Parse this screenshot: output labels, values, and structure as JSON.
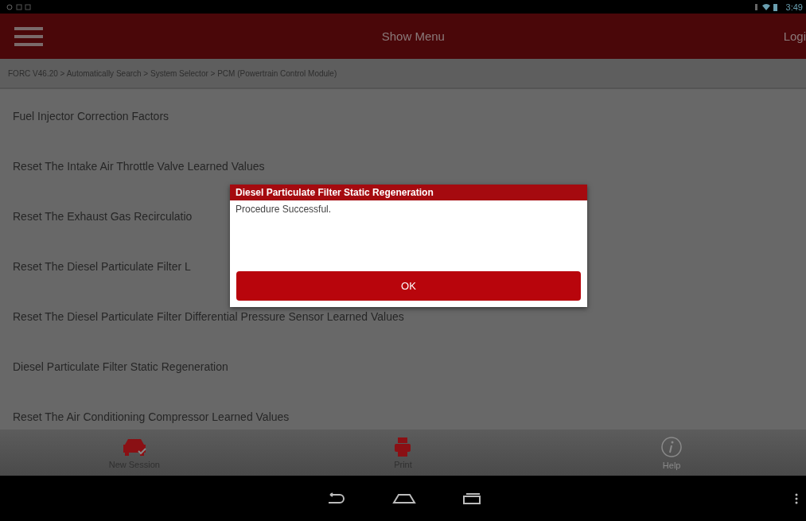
{
  "status_bar": {
    "time": "3:49"
  },
  "header": {
    "title": "Show Menu",
    "login": "Logi"
  },
  "breadcrumb": "FORC V46.20 > Automatically Search > System Selector > PCM (Powertrain Control Module)",
  "menu_items": [
    "Fuel Injector Correction Factors",
    "Reset The Intake Air Throttle Valve Learned Values",
    "Reset The Exhaust Gas Recirculatio",
    "Reset The Diesel Particulate Filter L",
    "Reset The Diesel Particulate Filter Differential Pressure Sensor Learned Values",
    "Diesel Particulate Filter Static Regeneration",
    "Reset The Air Conditioning Compressor Learned Values"
  ],
  "dialog": {
    "title": "Diesel Particulate Filter Static Regeneration",
    "message": "Procedure Successful.",
    "button": "OK"
  },
  "bottom_bar": [
    {
      "kind": "car",
      "label": "New Session",
      "disabled": false
    },
    {
      "kind": "print",
      "label": "Print",
      "disabled": false
    },
    {
      "kind": "help",
      "label": "Help",
      "disabled": true
    }
  ]
}
